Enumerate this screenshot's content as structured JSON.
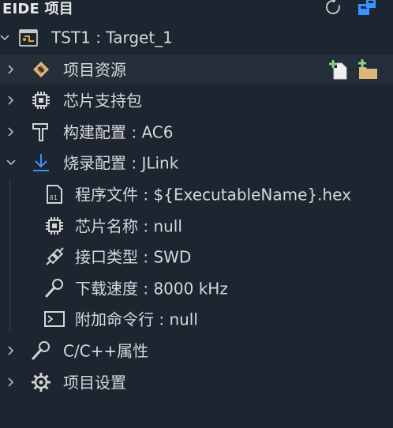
{
  "header": {
    "title": "EIDE 项目",
    "refresh_icon": "refresh-icon",
    "open_icon": "open-project-icon"
  },
  "tree": {
    "root": {
      "label": "TST1 : Target_1",
      "icon": "project-icon"
    },
    "items": [
      {
        "label": "项目资源",
        "icon": "resources-icon",
        "expanded": false
      },
      {
        "label": "芯片支持包",
        "icon": "chip-icon",
        "expanded": false
      },
      {
        "label": "构建配置 : AC6",
        "icon": "hammer-icon",
        "expanded": false
      },
      {
        "label": "烧录配置 : JLink",
        "icon": "download-icon",
        "expanded": true
      },
      {
        "label": "C/C++属性",
        "icon": "wrench-icon",
        "expanded": false
      },
      {
        "label": "项目设置",
        "icon": "gear-icon",
        "expanded": false
      }
    ],
    "flash_children": [
      {
        "label": "程序文件 : ${ExecutableName}.hex",
        "icon": "binary-file-icon"
      },
      {
        "label": "芯片名称 : null",
        "icon": "chip-icon"
      },
      {
        "label": "接口类型 : SWD",
        "icon": "plug-icon"
      },
      {
        "label": "下载速度 : 8000 kHz",
        "icon": "wrench-icon"
      },
      {
        "label": "附加命令行 : null",
        "icon": "terminal-icon"
      }
    ],
    "resource_actions": [
      {
        "name": "add-file-icon"
      },
      {
        "name": "add-folder-icon"
      }
    ]
  },
  "colors": {
    "background": "#1c2530",
    "selected_row": "#252f3a",
    "text": "#d8d8d8",
    "accent_blue": "#3794ff",
    "folder_orange": "#dcb67a",
    "add_green": "#89d185"
  }
}
